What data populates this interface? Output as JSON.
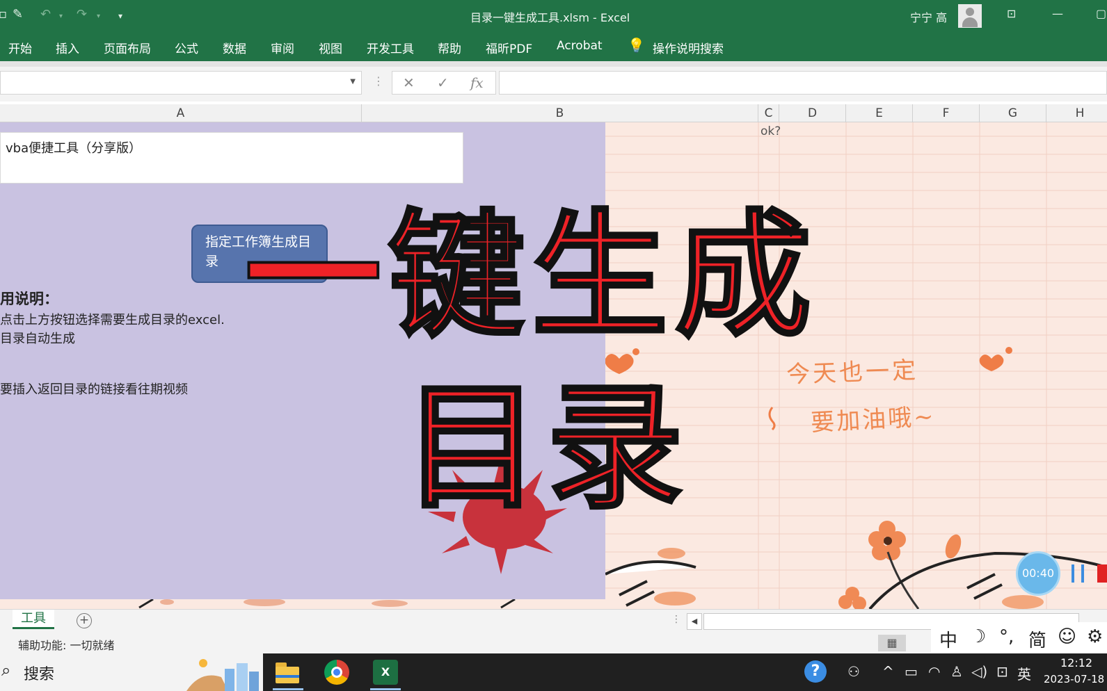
{
  "titlebar": {
    "doc_title": "目录一键生成工具.xlsm  -  Excel",
    "user_name": "宁宁 高",
    "quick_access": [
      "save-icon",
      "brush-icon",
      "undo-icon",
      "redo-icon",
      "customize-icon"
    ]
  },
  "ribbon": {
    "tabs": [
      "开始",
      "插入",
      "页面布局",
      "公式",
      "数据",
      "审阅",
      "视图",
      "开发工具",
      "帮助",
      "福昕PDF",
      "Acrobat"
    ],
    "tell_me": "操作说明搜索"
  },
  "formula_bar": {
    "name_box": "",
    "cancel": "✕",
    "enter": "✓",
    "fx": "fx",
    "content": ""
  },
  "columns": [
    "A",
    "B",
    "C",
    "D",
    "E",
    "F",
    "G",
    "H"
  ],
  "sheet": {
    "title_cell": "vba便捷工具（分享版）",
    "macro_button": "指定工作簿生成目录",
    "usage_title": "用说明：",
    "usage_lines": [
      "点击上方按钮选择需要生成目录的excel.",
      "目录自动生成",
      "要插入返回目录的链接看往期视频"
    ],
    "c_cell": "ok?",
    "handwriting_line1": "今天也一定",
    "handwriting_line2": "要加油哦~"
  },
  "overlay": {
    "line1": "一键生成",
    "line2": "目录",
    "color": "#ee2227"
  },
  "recorder": {
    "elapsed": "00:40"
  },
  "sheet_tabs": {
    "active": "工具",
    "add": "+"
  },
  "status": {
    "accessibility": "辅助功能: 一切就绪"
  },
  "ime": {
    "items": [
      "中",
      "☽",
      "°,",
      "简",
      "☺",
      "⚙"
    ]
  },
  "taskbar": {
    "search_label": "搜索",
    "pinned": [
      "file-explorer-icon",
      "chrome-icon",
      "excel-icon"
    ],
    "excel_letter": "X",
    "help": "?",
    "language": "英",
    "time": "12:12",
    "date": "2023-07-18"
  },
  "colors": {
    "excel_green": "#217346",
    "purple_panel": "#c9c2e1",
    "button_blue": "#5774ad"
  }
}
